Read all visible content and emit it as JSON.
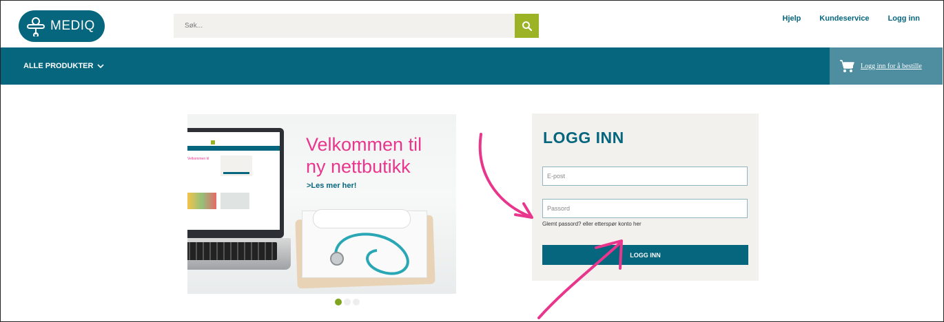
{
  "header": {
    "brand": "MEDIQ",
    "search": {
      "placeholder": "Søk..."
    },
    "links": {
      "help": "Hjelp",
      "customer_service": "Kundeservice",
      "login": "Logg inn"
    }
  },
  "nav": {
    "all_products": "ALLE PRODUKTER",
    "cart_link": "Logg inn for å bestille"
  },
  "banner": {
    "title_line1": "Velkommen til",
    "title_line2": "ny nettbutikk",
    "read_more": ">Les mer her!",
    "dots_total": 3,
    "dots_active": 1
  },
  "login": {
    "title": "LOGG INN",
    "email_placeholder": "E-post",
    "password_placeholder": "Passord",
    "forgot_text": "Glemt passord? eller etterspør konto her",
    "submit_label": "LOGG INN"
  },
  "colors": {
    "brand_teal": "#05667e",
    "search_green": "#9bb324",
    "accent_pink": "#e9368d"
  }
}
